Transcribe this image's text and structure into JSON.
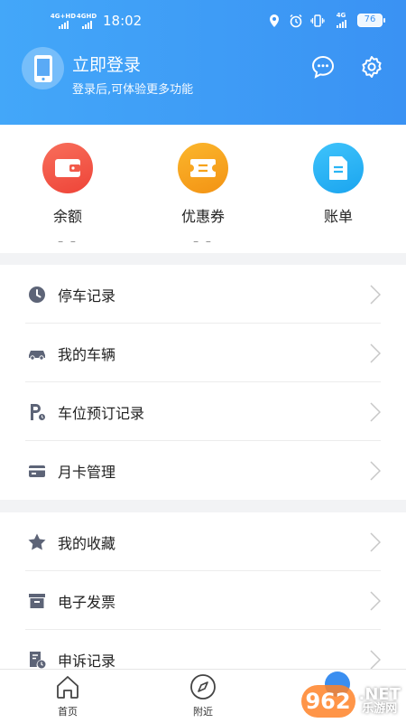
{
  "status_bar": {
    "sim1": "4G+HD",
    "sim2": "4GHD",
    "time": "18:02",
    "battery": "76",
    "net_small": "4G"
  },
  "header": {
    "title": "立即登录",
    "subtitle": "登录后,可体验更多功能",
    "message_icon": "chat-icon",
    "settings_icon": "gear-icon"
  },
  "quick": [
    {
      "label": "余额",
      "value": "– –",
      "icon": "wallet-icon",
      "color": "#f25a4a"
    },
    {
      "label": "优惠券",
      "value": "– –",
      "icon": "coupon-icon",
      "color": "#f6a21a"
    },
    {
      "label": "账单",
      "value": "",
      "icon": "bill-icon",
      "color": "#29b5f5"
    }
  ],
  "menu_group1": [
    {
      "label": "停车记录",
      "icon": "clock-icon"
    },
    {
      "label": "我的车辆",
      "icon": "car-icon"
    },
    {
      "label": "车位预订记录",
      "icon": "parking-icon"
    },
    {
      "label": "月卡管理",
      "icon": "card-icon"
    }
  ],
  "menu_group2": [
    {
      "label": "我的收藏",
      "icon": "star-icon"
    },
    {
      "label": "电子发票",
      "icon": "invoice-icon"
    },
    {
      "label": "申诉记录",
      "icon": "appeal-icon"
    }
  ],
  "tabbar": [
    {
      "label": "首页",
      "icon": "home-icon"
    },
    {
      "label": "附近",
      "icon": "compass-icon"
    }
  ],
  "watermark": {
    "badge": "962",
    "line1": ".NET",
    "line2": "乐游网"
  },
  "colors": {
    "header": "#3a92f3",
    "menu_icon": "#5d6477",
    "chevron": "#c7c7c7"
  }
}
